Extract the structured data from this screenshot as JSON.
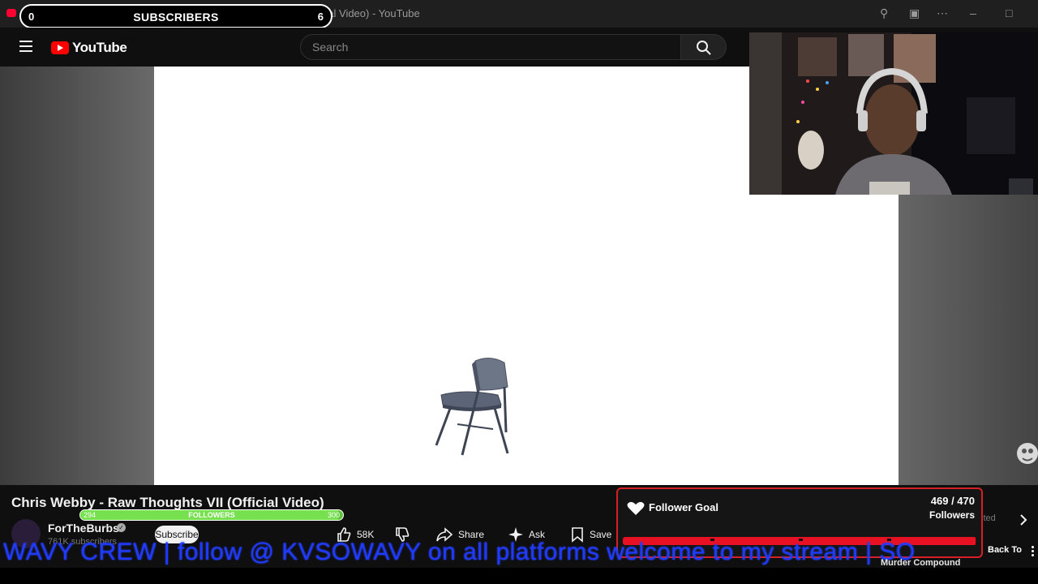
{
  "browser": {
    "tab_title": "YouTube - (3) Chris Webby - Raw Thoughts VII (Official Video) - YouTube"
  },
  "subscribers_overlay": {
    "label": "SUBSCRIBERS",
    "start": "0",
    "goal": "6"
  },
  "masthead": {
    "logo_text": "YouTube",
    "search_placeholder": "Search"
  },
  "video": {
    "title": "Chris Webby - Raw Thoughts VII (Official Video)"
  },
  "followers_bar": {
    "label": "FOLLOWERS",
    "current": "294",
    "target": "300",
    "progress": 0.98
  },
  "channel": {
    "name": "ForTheBurbs",
    "subscribers": "761K subscribers",
    "subscribe_label": "Subscribe"
  },
  "actions": {
    "like_count": "58K",
    "share_label": "Share",
    "ask_label": "Ask",
    "save_label": "Save"
  },
  "follower_goal": {
    "title": "Follower Goal",
    "count": "469 / 470",
    "count_label": "Followers",
    "progress": 0.998
  },
  "ticker": {
    "text": "WAVY CREW  | follow @ KVSOWAVY on all platforms welcome to my stream | SO"
  },
  "recommendations": {
    "partial_label": "ited",
    "back_to": "Back To",
    "murder_compound": "Murder Compound"
  },
  "colors": {
    "youtube_red": "#ff0000",
    "goal_red": "#e81123",
    "followers_green": "#76e04f",
    "ticker_blue": "#1f3bff"
  }
}
